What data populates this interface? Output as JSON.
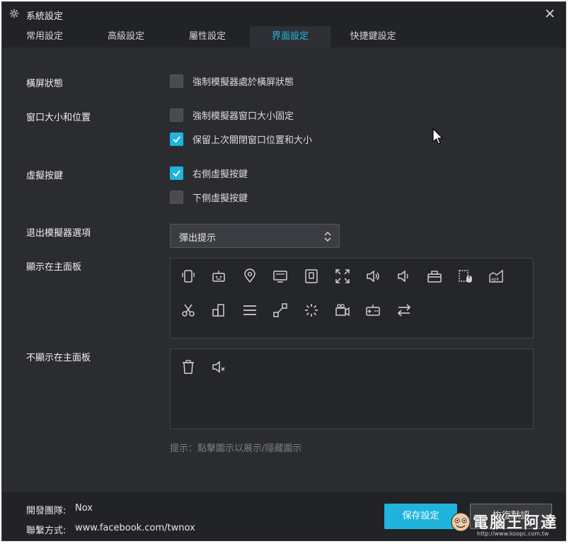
{
  "window": {
    "title": "系統設定",
    "close_icon": "close-icon"
  },
  "tabs": [
    {
      "label": "常用設定",
      "active": false
    },
    {
      "label": "高級設定",
      "active": false
    },
    {
      "label": "屬性設定",
      "active": false
    },
    {
      "label": "界面設定",
      "active": true
    },
    {
      "label": "快捷鍵設定",
      "active": false
    }
  ],
  "settings": {
    "landscape": {
      "label": "橫屏狀態",
      "options": [
        {
          "label": "強制模擬器處於橫屏狀態",
          "checked": false
        }
      ]
    },
    "window_size": {
      "label": "窗口大小和位置",
      "options": [
        {
          "label": "強制模擬器窗口大小固定",
          "checked": false
        },
        {
          "label": "保留上次關閉窗口位置和大小",
          "checked": true
        }
      ]
    },
    "virtual_keys": {
      "label": "虛擬按鍵",
      "options": [
        {
          "label": "右側虛擬按鍵",
          "checked": true
        },
        {
          "label": "下側虛擬按鍵",
          "checked": false
        }
      ]
    },
    "exit_option": {
      "label": "退出模擬器選項",
      "selected": "彈出提示"
    },
    "shown_panel": {
      "label": "顯示在主面板",
      "icons": [
        "shake-phone-icon",
        "robot-icon",
        "location-icon",
        "screen-icon",
        "backup-icon",
        "fullscreen-icon",
        "volume-up-icon",
        "volume-down-icon",
        "toolbox-icon",
        "keyboard-mouse-icon",
        "apk-install-icon",
        "scissors-icon",
        "multi-instance-icon",
        "menu-icon",
        "resize-icon",
        "loading-icon",
        "video-record-icon",
        "gamepad-icon",
        "sync-icon"
      ]
    },
    "hidden_panel": {
      "label": "不顯示在主面板",
      "icons": [
        "trash-icon",
        "mute-icon"
      ]
    },
    "hint": "提示：點擊圖示以展示/隱藏圖示"
  },
  "footer": {
    "developer_label": "開發團隊:",
    "developer_value": "Nox",
    "contact_label": "聯繫方式:",
    "contact_value": "www.facebook.com/twnox",
    "save_label": "保存設定",
    "restore_label": "恢復默認"
  },
  "watermark": {
    "text": "電腦王阿達",
    "sub": "http://www.koopc.com.tw"
  },
  "colors": {
    "accent": "#1fb3de",
    "background": "#2b2c30",
    "titlebar": "#222327"
  }
}
